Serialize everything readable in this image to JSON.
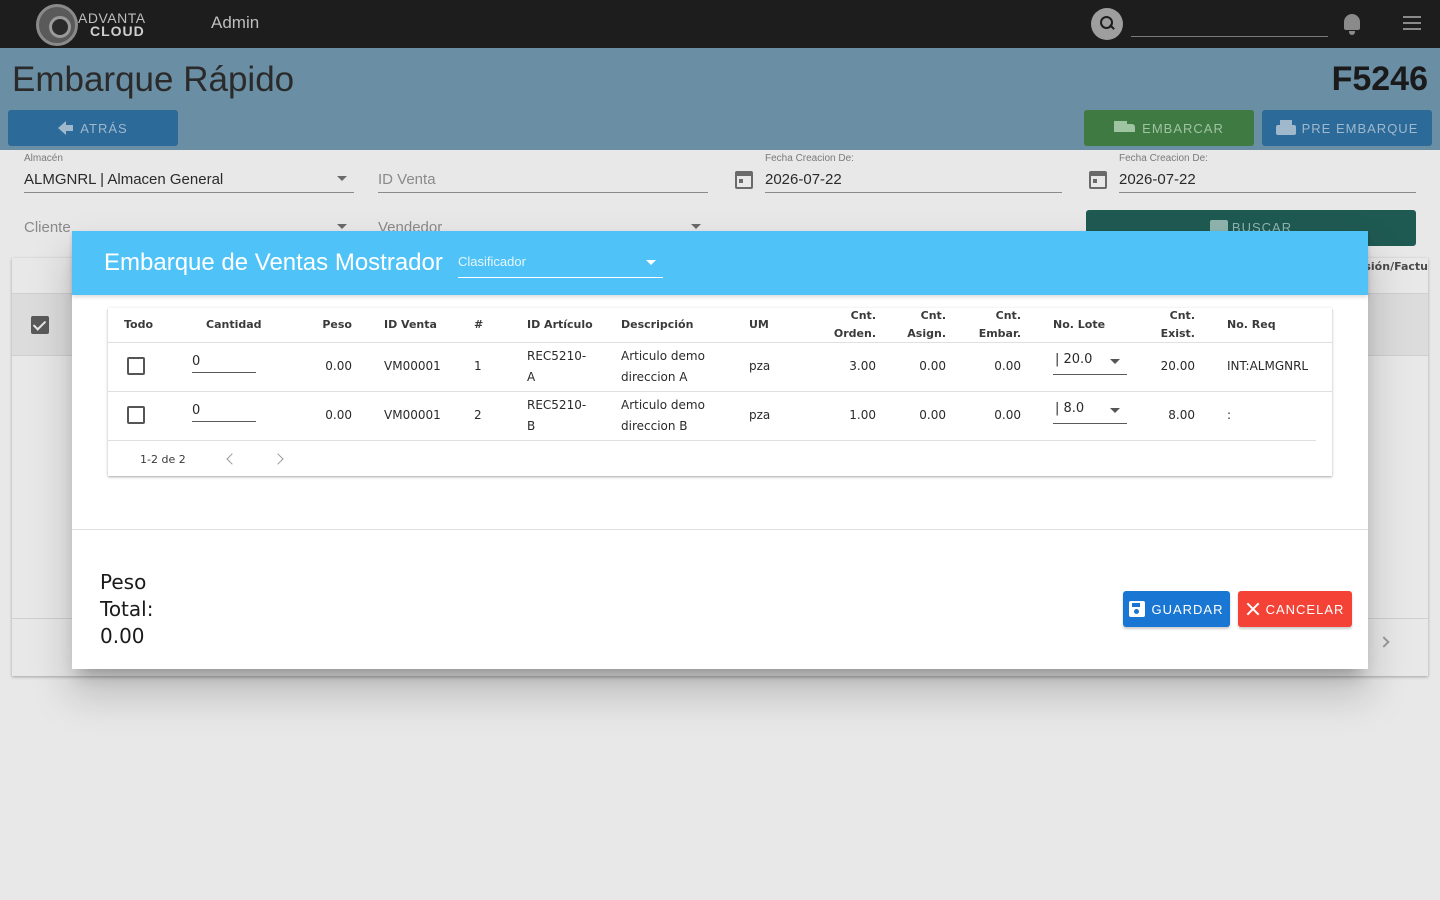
{
  "topbar": {
    "logo_line1": "ADVANTA",
    "logo_line2": "CLOUD",
    "title": "Admin",
    "search_value": ""
  },
  "page": {
    "title": "Embarque Rápido",
    "code": "F5246",
    "back_label": "ATRÁS",
    "ship_label": "EMBARCAR",
    "pre_ship_label": "PRE EMBARQUE"
  },
  "filters": {
    "almacen_label": "Almacén",
    "almacen_value": "ALMGNRL | Almacen General",
    "id_venta_placeholder": "ID Venta",
    "fecha1_label": "Fecha Creacion De:",
    "fecha1_value": "2026-07-22",
    "fecha2_label": "Fecha Creacion De:",
    "fecha2_value": "2026-07-22",
    "cliente_placeholder": "Cliente",
    "vendedor_placeholder": "Vendedor",
    "search_label": "BUSCAR"
  },
  "background_table": {
    "partial_header": "ulsión/Factu"
  },
  "dialog": {
    "title": "Embarque de Ventas Mostrador",
    "clasificador_placeholder": "Clasificador",
    "columns": {
      "todo": "Todo",
      "cantidad": "Cantidad",
      "peso": "Peso",
      "id_venta": "ID Venta",
      "num": "#",
      "id_articulo": "ID Artículo",
      "descripcion": "Descripción",
      "um": "UM",
      "cnt_orden_1": "Cnt.",
      "cnt_orden_2": "Orden.",
      "cnt_asign_1": "Cnt.",
      "cnt_asign_2": "Asign.",
      "cnt_embar_1": "Cnt.",
      "cnt_embar_2": "Embar.",
      "no_lote": "No. Lote",
      "cnt_exist_1": "Cnt.",
      "cnt_exist_2": "Exist.",
      "no_req": "No. Req"
    },
    "rows": [
      {
        "cantidad": "0",
        "peso": "0.00",
        "id_venta": "VM00001",
        "num": "1",
        "id_articulo_1": "REC5210-",
        "id_articulo_2": "A",
        "descripcion_1": "Articulo demo",
        "descripcion_2": "direccion A",
        "um": "pza",
        "cnt_orden": "3.00",
        "cnt_asign": "0.00",
        "cnt_embar": "0.00",
        "no_lote": "| 20.0",
        "cnt_exist": "20.00",
        "no_req": "INT:ALMGNRL"
      },
      {
        "cantidad": "0",
        "peso": "0.00",
        "id_venta": "VM00001",
        "num": "2",
        "id_articulo_1": "REC5210-",
        "id_articulo_2": "B",
        "descripcion_1": "Articulo demo",
        "descripcion_2": "direccion B",
        "um": "pza",
        "cnt_orden": "1.00",
        "cnt_asign": "0.00",
        "cnt_embar": "0.00",
        "no_lote": "| 8.0",
        "cnt_exist": "8.00",
        "no_req": ":"
      }
    ],
    "pagination": "1-2 de 2",
    "peso_total_line1": "Peso",
    "peso_total_line2": "Total:",
    "peso_total_value": "0.00",
    "save_label": "GUARDAR",
    "cancel_label": "CANCELAR"
  },
  "colors": {
    "dialog_header": "#4fc3f7",
    "save_button": "#1976d2",
    "cancel_button": "#f44336",
    "topbar": "#1d1d1d"
  }
}
